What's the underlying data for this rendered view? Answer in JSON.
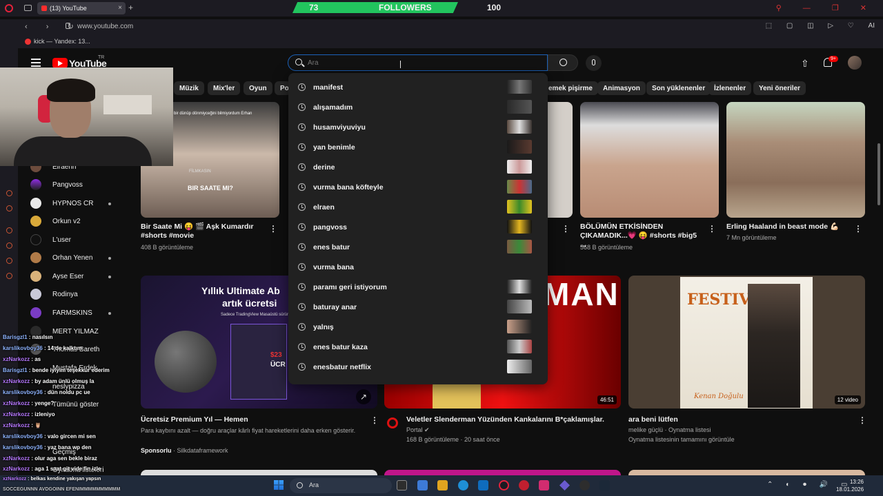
{
  "browser": {
    "tab_title": "(13) YouTube",
    "url": "www.youtube.com",
    "bookmark": "kick — Yandex: 13...",
    "new_tab": "+",
    "nav_buttons": "‹ › ↻",
    "extensions": "⬚ ▢ ◫ ▷ ♡",
    "ai_label": "AI",
    "window_controls": "⚲ — ❐ ✕"
  },
  "overlay": {
    "followers_current": "73",
    "followers_label": "FOLLOWERS",
    "followers_goal": "100"
  },
  "youtube": {
    "logo_text": "YouTube",
    "region": "TR",
    "search": {
      "placeholder": "Ara",
      "value": ""
    },
    "notification_count": "9+",
    "chips": [
      "Müzik",
      "Mix'ler",
      "Oyun",
      "Po",
      "emek pişirme",
      "Animasyon",
      "Son yüklenenler",
      "İzlenenler",
      "Yeni öneriler"
    ],
    "sidebar": [
      "Elraenn",
      "Pangvoss",
      "HYPNOS CR",
      "Orkun v2",
      "L'user",
      "Orhan Yenen",
      "Ayse Eser",
      "Rodinya",
      "FARMSKINS",
      "MERT YILMAZ",
      "Thomas Bareth",
      "Mustafa Erdek",
      "neslypizza",
      "Tümünü göster",
      "Geçmiş",
      "Oynatma listeleri"
    ],
    "suggestions": [
      "manifest",
      "alışamadım",
      "husamviyuviyu",
      "yan benimle",
      "derine",
      "vurma bana köfteyle",
      "elraen",
      "pangvoss",
      "enes batur",
      "vurma bana",
      "paramı geri istiyorum",
      "baturay anar",
      "yalnış",
      "enes batur kaza",
      "enesbatur netflix"
    ],
    "videos": [
      {
        "title": "Bir Saate Mi 😝 🎬 Aşk Kumardır #shorts #movie",
        "meta": "408 B görüntüleme",
        "overlay": "BIR SAATE MI?",
        "thumb_text": "FİLMKASIN",
        "caption": "bir dünüp dönmiyceğini bilmiyordum Erhan"
      },
      {
        "title": "BÖLÜMÜN ETKİSİNDEN ÇIKAMADIK...💗 😝 #shorts #big5 ...",
        "meta": "568 B görüntüleme"
      },
      {
        "title": "Erling Haaland in beast mode 💪🏻",
        "meta": "7 Mn görüntüleme"
      },
      {
        "title": "Ücretsiz Premium Yıl — Hemen",
        "desc": "Para kaybını azalt — doğru araçlar kârlı fiyat hareketlerini daha erken gösterir.",
        "sponsor_label": "Sponsorlu",
        "sponsor": "Silkdataframework",
        "ad_line1": "Yıllık Ultimate Ab",
        "ad_line2": "artık ücretsi",
        "ad_line3": "Sadece TradingView Masaüstü sürüm",
        "ad_price": "$23",
        "ad_button": "ÜCR"
      },
      {
        "title": "Veletler Slenderman Yüzünden Kankalarını B*çaklamışlar.",
        "channel": "Portal",
        "meta": "168 B görüntüleme · 20 saat önce",
        "duration": "46:51",
        "thumb_text": "MAN"
      },
      {
        "title": "ara beni lütfen",
        "channel": "melike güçlü · Oynatma listesi",
        "meta": "Oynatma listesinin tamamını görüntüle",
        "count": "12 video",
        "thumb_text": "FESTIVAL",
        "signature": "Kenan Doğulu"
      }
    ]
  },
  "chat": [
    {
      "user": "Barisgzl1",
      "msg": "nasılsın"
    },
    {
      "user": "karslikovboy36",
      "msg": "14 de kalktım"
    },
    {
      "user": "xzNarkozz",
      "msg": "as"
    },
    {
      "user": "Barisgzl1",
      "msg": "bende iyiyim teşekkür ederim"
    },
    {
      "user": "xzNarkozz",
      "msg": "by adam ünlü olmuş la"
    },
    {
      "user": "karslikovboy36",
      "msg": "dün noldu pc ue"
    },
    {
      "user": "xzNarkozz",
      "msg": "yenge?"
    },
    {
      "user": "xzNarkozz",
      "msg": "izleniyo"
    },
    {
      "user": "xzNarkozz",
      "msg": "🦉"
    },
    {
      "user": "karslikovboy36",
      "msg": "valo gircen mi sen"
    },
    {
      "user": "karslikovboy36",
      "msg": "yaz bana wp den"
    },
    {
      "user": "xzNarkozz",
      "msg": "olur aga sen bekle biraz"
    },
    {
      "user": "xzNarkozz",
      "msg": "aga 1 saat git vide fin izle"
    },
    {
      "user": "xzNarkozz",
      "msg": "belkas kendine yakışan yapsın"
    },
    {
      "user": "",
      "msg": "SOCCEGUNNN AVDGOINN EFENIMMMMMMMMMM"
    }
  ],
  "taskbar": {
    "search": "Ara",
    "tray": "⌃ ◐ ⏺ 🔊 ▭",
    "time": "13:26",
    "date": "18.01.2026"
  }
}
